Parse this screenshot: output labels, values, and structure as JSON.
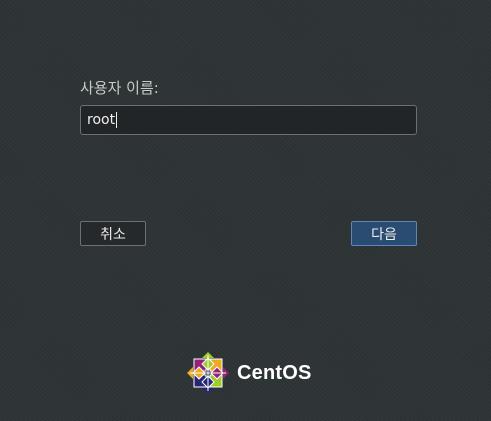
{
  "login": {
    "username_label": "사용자 이름:",
    "username_value": "root",
    "cancel_label": "취소",
    "next_label": "다음"
  },
  "brand": {
    "name": "CentOS",
    "logo_icon": "centos-logo-icon"
  },
  "colors": {
    "background": "#2e3436",
    "primary_button": "#2a4c72",
    "logo_green": "#9ccd2a",
    "logo_orange": "#efa724",
    "logo_blue": "#262577",
    "logo_purple": "#932279"
  }
}
